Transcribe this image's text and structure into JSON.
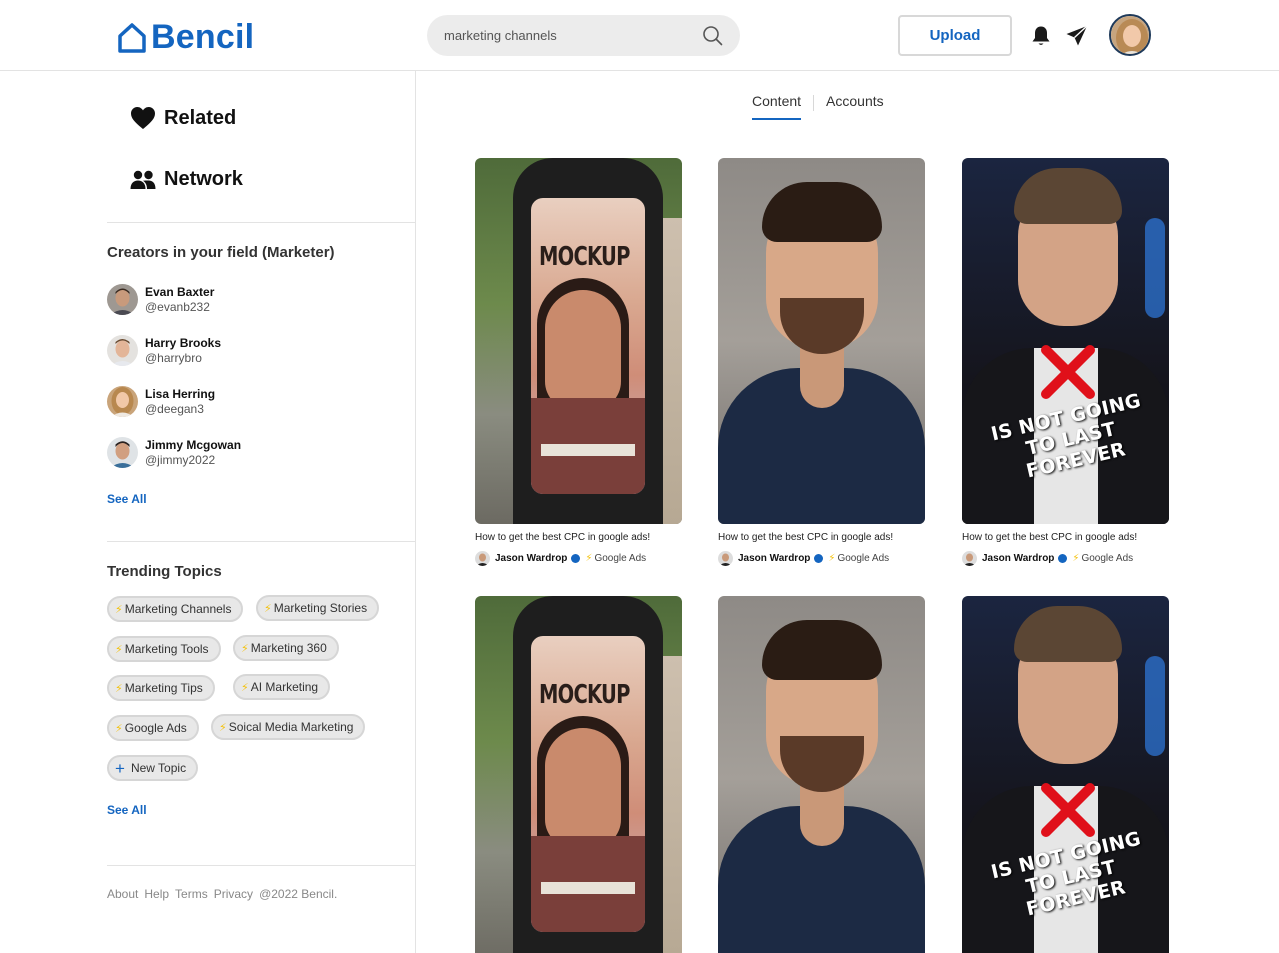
{
  "header": {
    "logo_text": "Bencil",
    "search": {
      "value": "marketing channels",
      "placeholder": ""
    },
    "upload_label": "Upload"
  },
  "sidebar": {
    "nav": [
      {
        "label": "Related",
        "icon": "heart-icon"
      },
      {
        "label": "Network",
        "icon": "people-icon"
      }
    ],
    "creators_title": "Creators in your field (Marketer)",
    "creators": [
      {
        "name": "Evan Baxter",
        "handle": "@evanb232"
      },
      {
        "name": "Harry Brooks",
        "handle": "@harrybro"
      },
      {
        "name": "Lisa Herring",
        "handle": "@deegan3"
      },
      {
        "name": "Jimmy Mcgowan",
        "handle": "@jimmy2022"
      }
    ],
    "creators_see_all": "See All",
    "topics_title": "Trending Topics",
    "topics": [
      "Marketing Channels",
      "Marketing Stories",
      "Marketing Tools",
      "Marketing 360",
      "Marketing Tips",
      "AI Marketing",
      "Google Ads",
      "Soical Media Marketing"
    ],
    "new_topic": "New Topic",
    "topics_see_all": "See All",
    "footer": [
      "About",
      "Help",
      "Terms",
      "Privacy",
      "@2022 Bencil."
    ]
  },
  "main": {
    "tabs": [
      {
        "label": "Content",
        "active": true
      },
      {
        "label": "Accounts",
        "active": false
      }
    ],
    "cards": [
      {
        "title": "How to get the best CPC in google ads!",
        "author": "Jason Wardrop",
        "tag": "Google Ads",
        "thumb": "mockup",
        "mock_title": "MOCKUP"
      },
      {
        "title": "How to get the best CPC in google ads!",
        "author": "Jason Wardrop",
        "tag": "Google Ads",
        "thumb": "man"
      },
      {
        "title": "How to get the best CPC in google ads!",
        "author": "Jason Wardrop",
        "tag": "Google Ads",
        "thumb": "dark",
        "overlay_line1": "IS NOT GOING",
        "overlay_line2": "TO LAST FOREVER"
      },
      {
        "title": "",
        "author": "",
        "tag": "",
        "thumb": "mockup",
        "mock_title": "MOCKUP"
      },
      {
        "title": "",
        "author": "",
        "tag": "",
        "thumb": "man"
      },
      {
        "title": "",
        "author": "",
        "tag": "",
        "thumb": "dark",
        "overlay_line1": "IS NOT GOING",
        "overlay_line2": "TO LAST FOREVER"
      }
    ]
  },
  "colors": {
    "brand": "#1465c0",
    "bolt": "#f4c20d",
    "chip_bg": "#e8e8e8"
  }
}
